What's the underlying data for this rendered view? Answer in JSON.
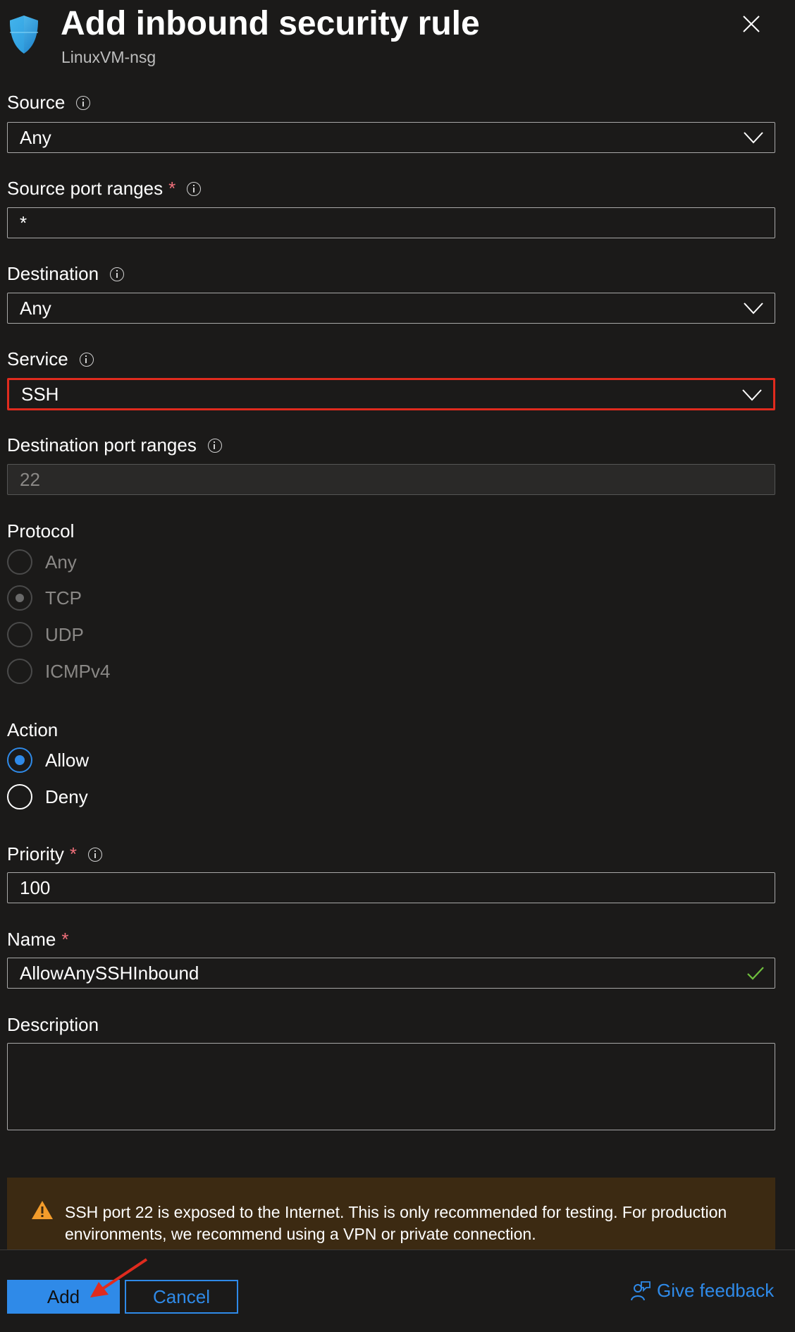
{
  "header": {
    "title": "Add inbound security rule",
    "subtitle": "LinuxVM-nsg",
    "icon": "shield-icon",
    "close_icon": "close-icon"
  },
  "form": {
    "source": {
      "label": "Source",
      "value": "Any"
    },
    "source_port_ranges": {
      "label": "Source port ranges",
      "value": "*"
    },
    "destination": {
      "label": "Destination",
      "value": "Any"
    },
    "service": {
      "label": "Service",
      "value": "SSH"
    },
    "destination_port_ranges": {
      "label": "Destination port ranges",
      "value": "22"
    },
    "protocol": {
      "label": "Protocol",
      "options": [
        "Any",
        "TCP",
        "UDP",
        "ICMPv4"
      ],
      "selected": "TCP"
    },
    "action": {
      "label": "Action",
      "options": [
        "Allow",
        "Deny"
      ],
      "selected": "Allow"
    },
    "priority": {
      "label": "Priority",
      "value": "100"
    },
    "name": {
      "label": "Name",
      "value": "AllowAnySSHInbound"
    },
    "description": {
      "label": "Description",
      "value": ""
    },
    "required_marker": "*"
  },
  "warning": {
    "icon": "warning-icon",
    "text": "SSH port 22 is exposed to the Internet. This is only recommended for testing. For production environments, we recommend using a VPN or private connection."
  },
  "footer": {
    "add_label": "Add",
    "cancel_label": "Cancel",
    "feedback_label": "Give feedback",
    "feedback_icon": "feedback-person-icon"
  },
  "colors": {
    "accent": "#2f8ae8",
    "highlight_border": "#e02b1e",
    "required": "#f1707b",
    "warning_bg": "#3c2a12",
    "background": "#1b1a19"
  }
}
